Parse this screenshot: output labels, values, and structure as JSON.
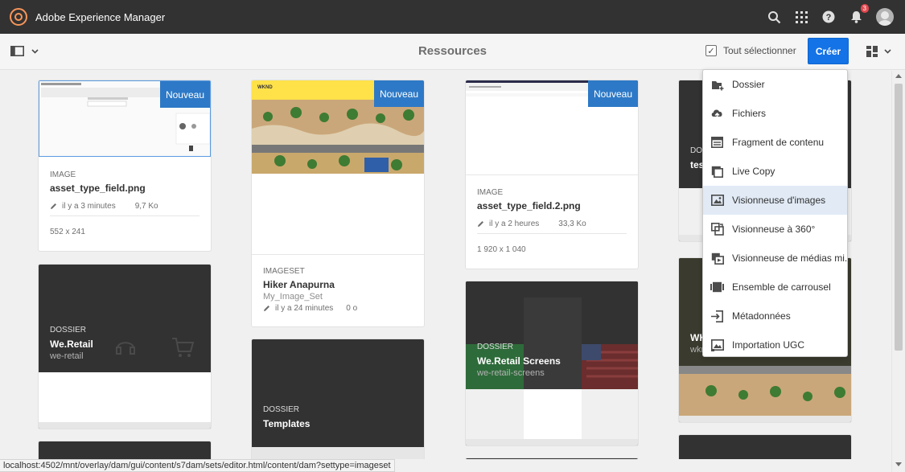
{
  "app": {
    "title": "Adobe Experience Manager",
    "notification_count": "3"
  },
  "actionbar": {
    "page_title": "Ressources",
    "select_all_label": "Tout sélectionner",
    "create_label": "Créer"
  },
  "cards": {
    "asset1": {
      "badge": "Nouveau",
      "type": "IMAGE",
      "title": "asset_type_field.png",
      "modified": "il y a 3 minutes",
      "size": "9,7 Ko",
      "dims": "552 x 241"
    },
    "imageset": {
      "badge": "Nouveau",
      "type": "IMAGESET",
      "title": "Hiker Anapurna",
      "subtitle": "My_Image_Set",
      "modified": "il y a 24 minutes",
      "size": "0 o",
      "thumb_text": "WKND"
    },
    "asset2": {
      "badge": "Nouveau",
      "type": "IMAGE",
      "title": "asset_type_field.2.png",
      "modified": "il y a 2 heures",
      "size": "33,3 Ko",
      "dims": "1 920 x 1 040"
    },
    "weretail": {
      "type": "DOSSIER",
      "title": "We.Retail",
      "subtitle": "we-retail"
    },
    "templates": {
      "type": "DOSSIER",
      "title": "Templates"
    },
    "screens": {
      "type": "DOSSIER",
      "title": "We.Retail Screens",
      "subtitle": "we-retail-screens"
    },
    "partial1": {
      "type": "DOSSIER",
      "title": "tes"
    },
    "partial2": {
      "title": "WK",
      "subtitle": "wkn"
    }
  },
  "create_menu": {
    "items": [
      {
        "label": "Dossier",
        "icon": "folder-add-icon"
      },
      {
        "label": "Fichiers",
        "icon": "upload-cloud-icon"
      },
      {
        "label": "Fragment de contenu",
        "icon": "content-fragment-icon"
      },
      {
        "label": "Live Copy",
        "icon": "live-copy-icon"
      },
      {
        "label": "Visionneuse d'images",
        "icon": "image-viewer-icon"
      },
      {
        "label": "Visionneuse à 360°",
        "icon": "spin-360-icon"
      },
      {
        "label": "Visionneuse de médias mi...",
        "icon": "mixed-media-icon"
      },
      {
        "label": "Ensemble de carrousel",
        "icon": "carousel-icon"
      },
      {
        "label": "Métadonnées",
        "icon": "metadata-import-icon"
      },
      {
        "label": "Importation UGC",
        "icon": "ugc-import-icon"
      }
    ],
    "highlighted_index": 4
  },
  "status": {
    "url": "localhost:4502/mnt/overlay/dam/gui/content/s7dam/sets/editor.html/content/dam?settype=imageset"
  },
  "colors": {
    "accent": "#1473e6",
    "badge": "#2d79c7",
    "topbar": "#323232",
    "notification": "#e34850"
  }
}
